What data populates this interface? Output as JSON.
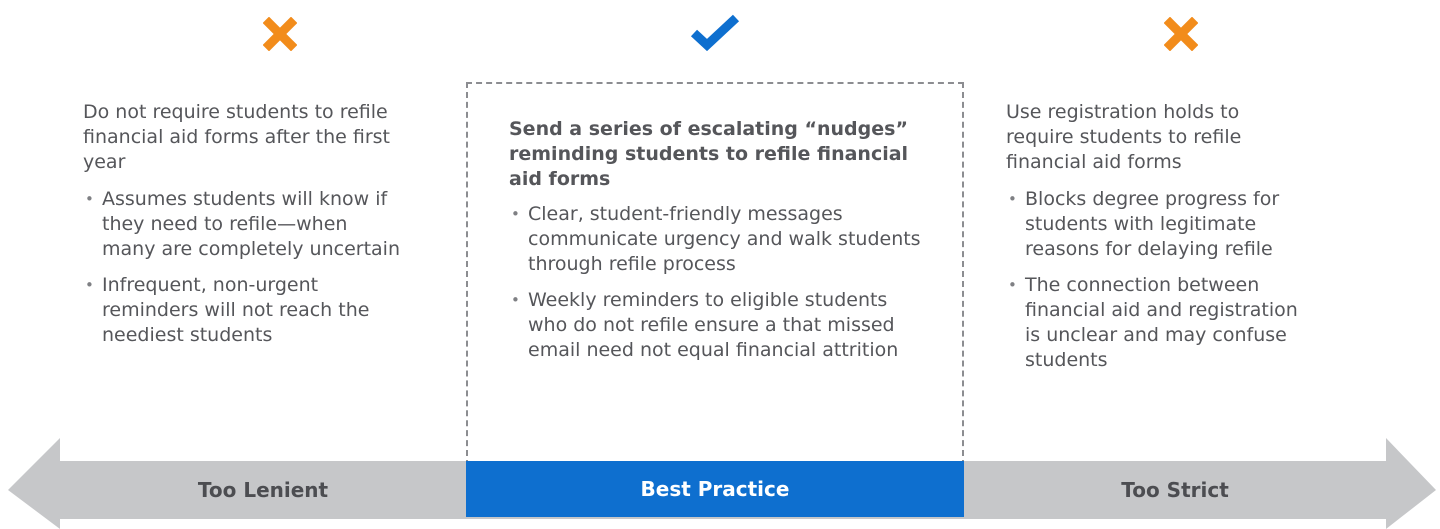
{
  "colors": {
    "x_mark": "#f28c1b",
    "check_mark": "#0e6fcf",
    "arrow": "#c6c7c9",
    "best_practice_bar": "#0e6fcf",
    "text": "#55565a"
  },
  "icons": {
    "left": "x-mark-icon",
    "middle": "checkmark-icon",
    "right": "x-mark-icon"
  },
  "left": {
    "heading": "Do not require students to refile financial aid forms after the first year",
    "bullets": [
      "Assumes students will know if they need to refile—when many are completely uncertain",
      "Infrequent, non-urgent reminders will not reach the neediest students"
    ]
  },
  "middle": {
    "heading": "Send a series of escalating “nudges” reminding students to refile financial aid forms",
    "bullets": [
      "Clear, student-friendly messages communicate urgency and walk students through refile process",
      "Weekly reminders to eligible students who do not refile ensure a that missed email need not equal financial attrition"
    ]
  },
  "right": {
    "heading": "Use registration holds to require students to refile financial aid forms",
    "bullets": [
      "Blocks degree progress for students with legitimate reasons for delaying refile",
      "The connection between financial aid and registration is unclear and may confuse students"
    ]
  },
  "spectrum": {
    "left_label": "Too Lenient",
    "middle_label": "Best Practice",
    "right_label": "Too Strict"
  }
}
